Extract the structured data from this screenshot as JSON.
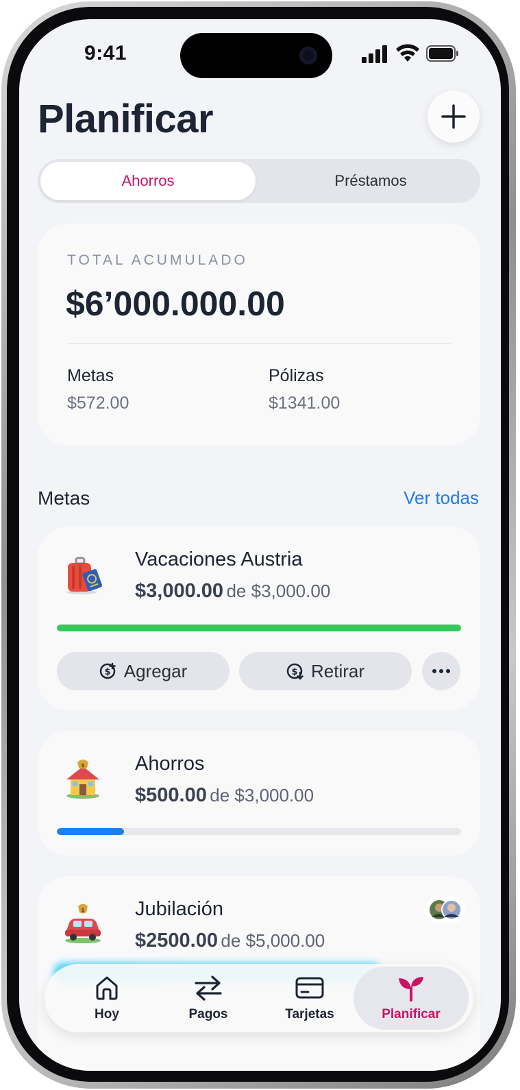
{
  "status_bar": {
    "time": "9:41"
  },
  "header": {
    "title": "Planificar"
  },
  "segmented": {
    "active": "Ahorros",
    "inactive": "Préstamos"
  },
  "summary": {
    "label": "TOTAL ACUMULADO",
    "total": "$6’000.000.00",
    "metas_label": "Metas",
    "metas_value": "$572.00",
    "polizas_label": "Pólizas",
    "polizas_value": "$1341.00"
  },
  "goals_section": {
    "title": "Metas",
    "link": "Ver todas"
  },
  "goals": [
    {
      "name": "Vacaciones Austria",
      "current": "$3,000.00",
      "of": "de $3,000.00",
      "progress": 1.0,
      "color": "#34c759",
      "icon": "luggage-passport-icon"
    },
    {
      "name": "Ahorros",
      "current": "$500.00",
      "of": "de $3,000.00",
      "progress": 0.1667,
      "color": "#1a7ff0",
      "icon": "house-money-icon"
    },
    {
      "name": "Jubilación",
      "current": "$2500.00",
      "of": "de $5,000.00",
      "progress": 0.5,
      "color": "#34d1ff",
      "icon": "car-money-icon"
    }
  ],
  "goal_actions": {
    "add": "Agregar",
    "withdraw": "Retirar"
  },
  "tabbar": [
    {
      "label": "Hoy",
      "icon": "home-icon"
    },
    {
      "label": "Pagos",
      "icon": "transfer-arrows-icon"
    },
    {
      "label": "Tarjetas",
      "icon": "card-icon"
    },
    {
      "label": "Planificar",
      "icon": "sprout-icon",
      "active": true
    }
  ],
  "colors": {
    "accent": "#cc1166",
    "link": "#1d7ef0",
    "progress_complete": "#34c759",
    "progress_partial": "#1a7ff0"
  }
}
